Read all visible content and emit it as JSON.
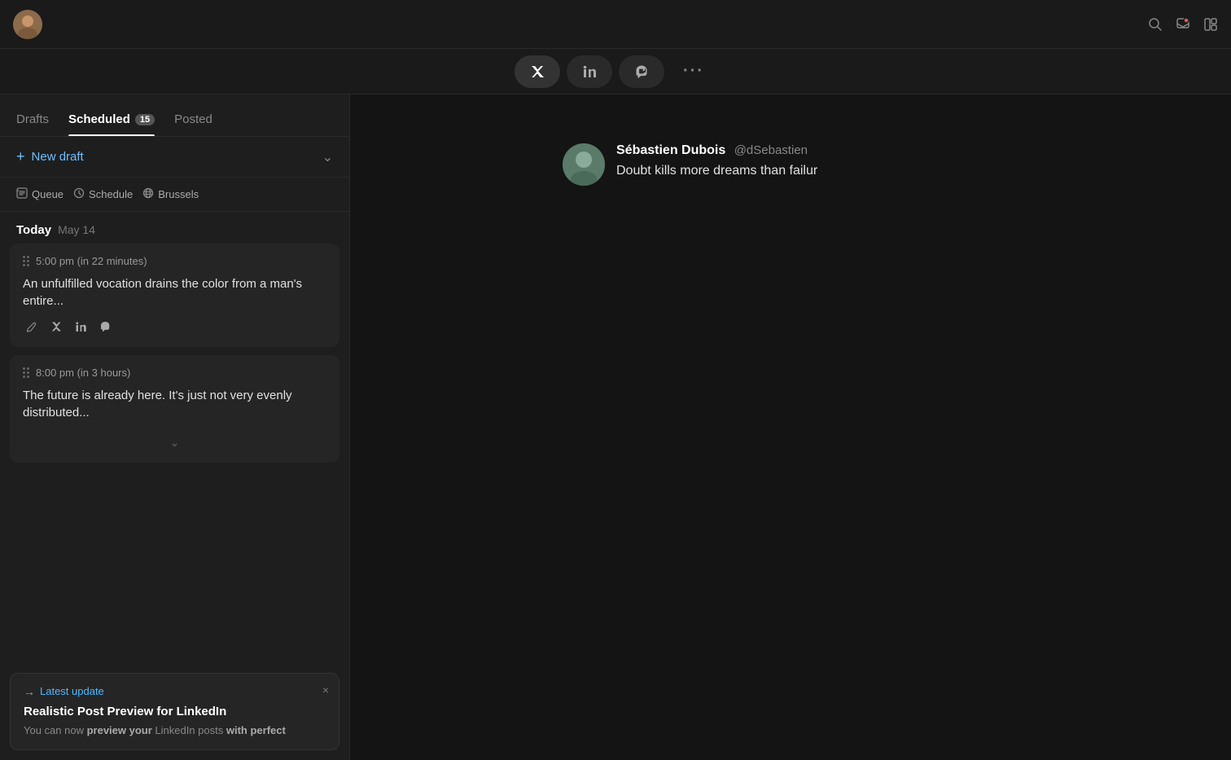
{
  "topbar": {
    "search_icon": "🔍",
    "notification_icon": "🔔",
    "layout_icon": "▦"
  },
  "platform_bar": {
    "platforms": [
      {
        "id": "x",
        "label": "𝕏",
        "active": true
      },
      {
        "id": "linkedin",
        "label": "in",
        "active": false
      },
      {
        "id": "mastodon",
        "label": "M",
        "active": false
      }
    ],
    "more_label": "···"
  },
  "tabs": [
    {
      "id": "drafts",
      "label": "Drafts",
      "active": false,
      "badge": null
    },
    {
      "id": "scheduled",
      "label": "Scheduled",
      "active": true,
      "badge": "15"
    },
    {
      "id": "posted",
      "label": "Posted",
      "active": false,
      "badge": null
    }
  ],
  "new_draft": {
    "label": "New draft",
    "plus": "+"
  },
  "queue_controls": [
    {
      "id": "queue",
      "icon": "⇱",
      "label": "Queue"
    },
    {
      "id": "schedule",
      "icon": "🕐",
      "label": "Schedule"
    },
    {
      "id": "brussels",
      "icon": "🌐",
      "label": "Brussels"
    }
  ],
  "date_section": {
    "today_label": "Today",
    "date": "May 14"
  },
  "posts": [
    {
      "id": "post1",
      "time": "5:00 pm (in 22 minutes)",
      "text": "An unfulfilled vocation drains the color from a man's entire...",
      "platforms": [
        "pen",
        "x",
        "linkedin",
        "mastodon"
      ]
    },
    {
      "id": "post2",
      "time": "8:00 pm (in 3 hours)",
      "text": "The future is already here. It's just not very evenly distributed...",
      "platforms": []
    }
  ],
  "update_banner": {
    "arrow": "→",
    "label": "Latest update",
    "close": "×",
    "title": "Realistic Post Preview for LinkedIn",
    "body_plain": "You can now ",
    "body_bold1": "preview your",
    "body_mid": " LinkedIn posts ",
    "body_bold2": "with perfect"
  },
  "preview": {
    "user": {
      "name": "Sébastien Dubois",
      "handle": "@dSebastien"
    },
    "text": "Doubt kills more dreams than failur"
  }
}
